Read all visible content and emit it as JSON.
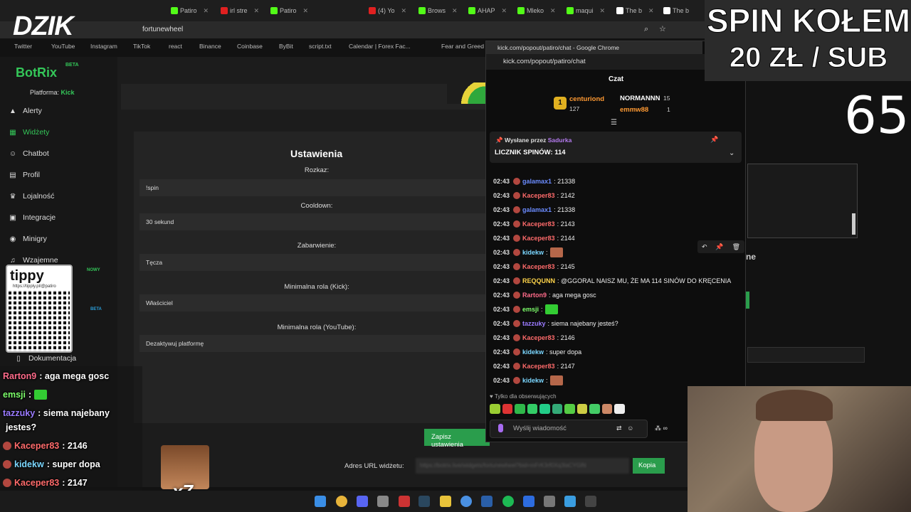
{
  "browser": {
    "tabs": [
      "Patiro",
      "irl stre",
      "Patiro",
      "(4) Yo",
      "Brows",
      "AHAP",
      "Mleko",
      "maqui",
      "The b",
      "The b"
    ],
    "url": "fortunewheel",
    "bookmarks": [
      "Twitter",
      "YouTube",
      "Instagram",
      "TikTok",
      "react",
      "Binance",
      "Coinbase",
      "ByBit",
      "script.txt",
      "Calendar | Forex Fac...",
      "Fear and Greed"
    ]
  },
  "logo": "DZIK",
  "sidebar": {
    "brand": "BotRix",
    "brand_badge": "BETA",
    "platform_label": "Platforma:",
    "platform_value": "Kick",
    "items": [
      {
        "label": "Alerty",
        "icon": "warning-icon"
      },
      {
        "label": "Widżety",
        "icon": "grid-icon"
      },
      {
        "label": "Chatbot",
        "icon": "robot-icon"
      },
      {
        "label": "Profil",
        "icon": "profile-icon"
      },
      {
        "label": "Lojalność",
        "icon": "trophy-icon"
      },
      {
        "label": "Integracje",
        "icon": "integration-icon"
      },
      {
        "label": "Minigry",
        "icon": "gamepad-icon"
      },
      {
        "label": "Wzajemne",
        "icon": "music-icon"
      },
      {
        "label": "Dokumentacja",
        "icon": "book-icon"
      }
    ],
    "badge_new": "NOWY",
    "badge_beta": "BETA"
  },
  "settings": {
    "title": "Ustawienia",
    "fields": [
      {
        "label": "Rozkaz:",
        "value": "!spin"
      },
      {
        "label": "Cooldown:",
        "value": "30 sekund"
      },
      {
        "label": "Zabarwienie:",
        "value": "Tęcza"
      },
      {
        "label": "Minimalna rola (Kick):",
        "value": "Właściciel"
      },
      {
        "label": "Minimalna rola (YouTube):",
        "value": "Dezaktywuj platformę"
      }
    ],
    "save_label": "Zapisz ustawienia",
    "url_label": "Adres URL widżetu:",
    "url_value": "https://botrix.live/widgets/fortunewheel?bid=mFrK3rf0Xq3laCYGlN",
    "copy_label": "Kopia"
  },
  "right_fragment": "ne",
  "chat": {
    "window_title": "kick.com/popout/patiro/chat - Google Chrome",
    "url": "kick.com/popout/patiro/chat",
    "title": "Czat",
    "leaderboard": [
      {
        "rank": "1",
        "name": "centuriond",
        "value": "127"
      },
      {
        "name": "NORMANNN",
        "value": "15"
      },
      {
        "name": "emmw88",
        "value": "1"
      }
    ],
    "pinned_by_label": "Wysłane przez",
    "pinned_by_user": "Sadurka",
    "pinned_text": "LICZNIK SPINÓW: 114",
    "messages": [
      {
        "time": "02:43",
        "user": "galamax1",
        "text": ": 21338",
        "color": "#6b8cff"
      },
      {
        "time": "02:43",
        "user": "Kaceper83",
        "text": ": 2142",
        "color": "#ff6b6b"
      },
      {
        "time": "02:43",
        "user": "galamax1",
        "text": ": 21338",
        "color": "#6b8cff"
      },
      {
        "time": "02:43",
        "user": "Kaceper83",
        "text": ": 2143",
        "color": "#ff6b6b"
      },
      {
        "time": "02:43",
        "user": "Kaceper83",
        "text": ": 2144",
        "color": "#ff6b6b"
      },
      {
        "time": "02:43",
        "user": "kidekw",
        "text": ":",
        "color": "#7bd7ff"
      },
      {
        "time": "02:43",
        "user": "Kaceper83",
        "text": ": 2145",
        "color": "#ff6b6b"
      },
      {
        "time": "02:43",
        "user": "REQQUNN",
        "text": ": @GGORAL NAISZ MU, ŻE MA 114 SINÓW DO KRĘCENIA",
        "color": "#ffd54a"
      },
      {
        "time": "02:43",
        "user": "Rarton9",
        "text": ": aga mega gosc",
        "color": "#ff6b8a"
      },
      {
        "time": "02:43",
        "user": "emsji",
        "text": ":",
        "color": "#7dff6b"
      },
      {
        "time": "02:43",
        "user": "tazzuky",
        "text": ": siema najebany jesteś?",
        "color": "#9b7bff"
      },
      {
        "time": "02:43",
        "user": "Kaceper83",
        "text": ": 2146",
        "color": "#ff6b6b"
      },
      {
        "time": "02:43",
        "user": "kidekw",
        "text": ": super dopa",
        "color": "#7bd7ff"
      },
      {
        "time": "02:43",
        "user": "Kaceper83",
        "text": ": 2147",
        "color": "#ff6b6b"
      },
      {
        "time": "02:43",
        "user": "kidekw",
        "text": ":",
        "color": "#7bd7ff"
      }
    ],
    "followers_only": "Tylko dla obserwujących",
    "input_placeholder": "Wyślij wiadomość"
  },
  "overlay": {
    "spin_line1": "SPIN KOŁEM",
    "spin_line2": "20 ZŁ / SUB",
    "counter": "65",
    "tippy_logo": "tippy",
    "tippy_url": "https://tipply.pl/@patiro",
    "x7": "x7",
    "messages": [
      {
        "user": "Rarton9",
        "text": ": aga mega gosc",
        "color": "#ff6b8a"
      },
      {
        "user": "emsji",
        "text": ":",
        "color": "#7dff6b"
      },
      {
        "user": "tazzuky",
        "text": ": siema najebany",
        "color": "#9b7bff"
      },
      {
        "user": "",
        "text": "jestes?",
        "color": "#fff"
      },
      {
        "user": "Kaceper83",
        "text": ": 2146",
        "color": "#ff6b6b"
      },
      {
        "user": "kidekw",
        "text": ": super dopa",
        "color": "#7bd7ff"
      },
      {
        "user": "Kaceper83",
        "text": ": 2147",
        "color": "#ff6b6b"
      },
      {
        "user": "kidekw",
        "text": ":",
        "color": "#7bd7ff"
      }
    ]
  }
}
